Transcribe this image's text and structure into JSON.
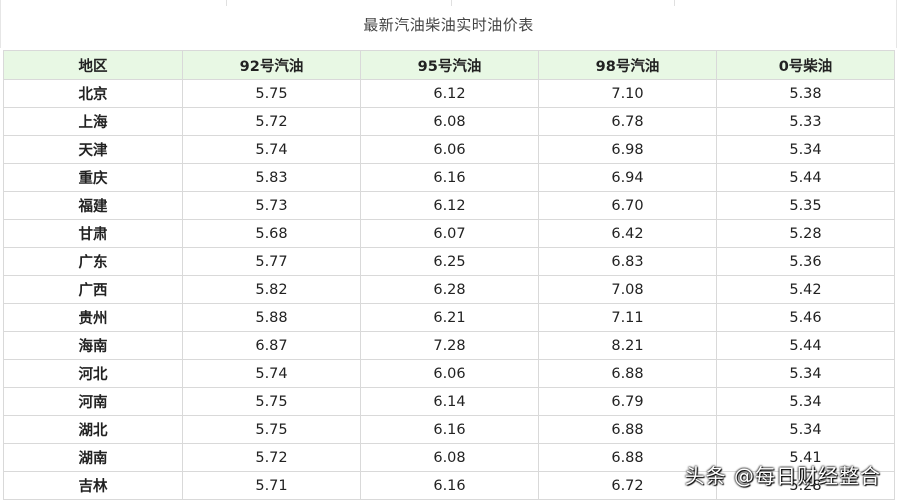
{
  "caption": "最新汽油柴油实时油价表",
  "columns": [
    "地区",
    "92号汽油",
    "95号汽油",
    "98号汽油",
    "0号柴油"
  ],
  "rows": [
    [
      "北京",
      "5.75",
      "6.12",
      "7.10",
      "5.38"
    ],
    [
      "上海",
      "5.72",
      "6.08",
      "6.78",
      "5.33"
    ],
    [
      "天津",
      "5.74",
      "6.06",
      "6.98",
      "5.34"
    ],
    [
      "重庆",
      "5.83",
      "6.16",
      "6.94",
      "5.44"
    ],
    [
      "福建",
      "5.73",
      "6.12",
      "6.70",
      "5.35"
    ],
    [
      "甘肃",
      "5.68",
      "6.07",
      "6.42",
      "5.28"
    ],
    [
      "广东",
      "5.77",
      "6.25",
      "6.83",
      "5.36"
    ],
    [
      "广西",
      "5.82",
      "6.28",
      "7.08",
      "5.42"
    ],
    [
      "贵州",
      "5.88",
      "6.21",
      "7.11",
      "5.46"
    ],
    [
      "海南",
      "6.87",
      "7.28",
      "8.21",
      "5.44"
    ],
    [
      "河北",
      "5.74",
      "6.06",
      "6.88",
      "5.34"
    ],
    [
      "河南",
      "5.75",
      "6.14",
      "6.79",
      "5.34"
    ],
    [
      "湖北",
      "5.75",
      "6.16",
      "6.88",
      "5.34"
    ],
    [
      "湖南",
      "5.72",
      "6.08",
      "6.88",
      "5.41"
    ],
    [
      "吉林",
      "5.71",
      "6.16",
      "6.72",
      "5.28"
    ]
  ],
  "watermark": "头条 @每日财经整合",
  "colors": {
    "header_bg": "#e8f8e4",
    "border": "#d9d9d9",
    "text": "#222222"
  }
}
